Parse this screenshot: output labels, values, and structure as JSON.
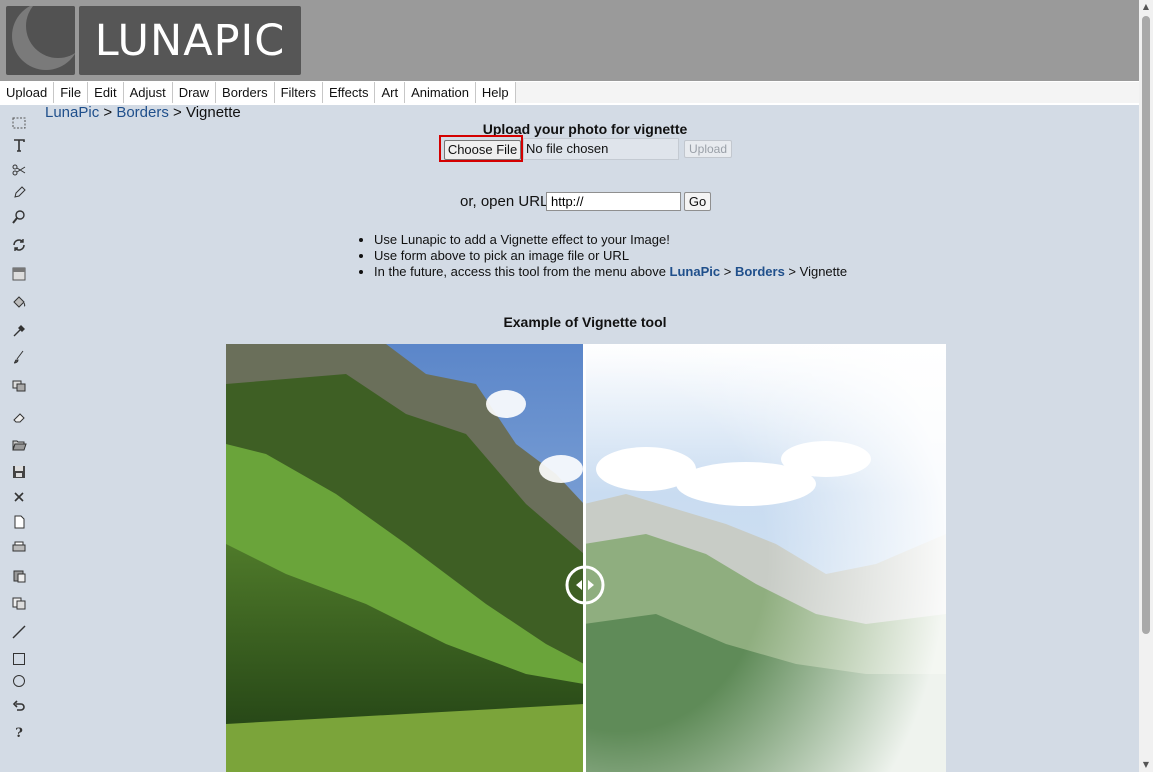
{
  "logo": {
    "text": "LUNAPIC"
  },
  "menu": [
    "Upload",
    "File",
    "Edit",
    "Adjust",
    "Draw",
    "Borders",
    "Filters",
    "Effects",
    "Art",
    "Animation",
    "Help"
  ],
  "breadcrumb": {
    "root": "LunaPic",
    "sep1": " > ",
    "section": "Borders",
    "sep2": " > ",
    "current": "Vignette"
  },
  "upload": {
    "title": "Upload your photo for vignette",
    "choose_label": "Choose File",
    "file_status": "No file chosen",
    "upload_label": "Upload"
  },
  "url": {
    "label": "or, open URL",
    "value": "http://",
    "go_label": "Go"
  },
  "bullets": {
    "b1": "Use Lunapic to add a Vignette effect to your Image!",
    "b2": "Use form above to pick an image file or URL",
    "b3_prefix": "In the future, access this tool from the menu above ",
    "b3_root": "LunaPic",
    "b3_sep1": " > ",
    "b3_section": "Borders",
    "b3_sep2": " > ",
    "b3_current": "Vignette"
  },
  "example": {
    "title": "Example of Vignette tool"
  },
  "tools": [
    "select-icon",
    "text-icon",
    "scissors-icon",
    "pencil-icon",
    "zoom-icon",
    "rotate-icon",
    "gradient-icon",
    "paint-bucket-icon",
    "eyedropper-icon",
    "brush-icon",
    "layers-icon",
    "eraser-icon",
    "open-folder-icon",
    "save-icon",
    "close-icon",
    "new-file-icon",
    "print-icon",
    "paste-icon",
    "copy-icon",
    "line-icon",
    "rectangle-icon",
    "circle-icon",
    "undo-icon",
    "help-icon"
  ],
  "colors": {
    "link": "#1f4f8b",
    "highlight": "#d40000",
    "background": "#d3dbe5",
    "header": "#9a9a9a"
  }
}
